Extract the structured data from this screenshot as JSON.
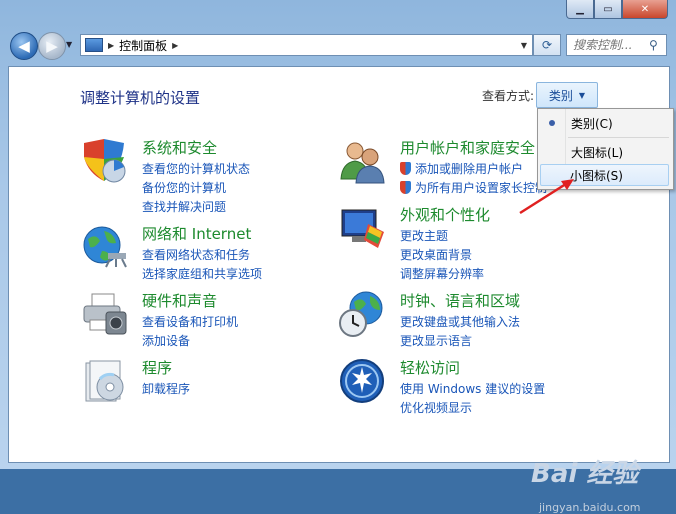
{
  "nav": {
    "address_path": "控制面板",
    "search_placeholder": "搜索控制..."
  },
  "page": {
    "title": "调整计算机的设置",
    "view_by_label": "查看方式:",
    "view_button": "类别"
  },
  "menu": {
    "items": [
      "类别(C)",
      "大图标(L)",
      "小图标(S)"
    ],
    "selected": "类别(C)",
    "highlighted": "小图标(S)"
  },
  "categories": [
    {
      "name": "系统和安全",
      "links": [
        "查看您的计算机状态",
        "备份您的计算机",
        "查找并解决问题"
      ]
    },
    {
      "name": "网络和 Internet",
      "links": [
        "查看网络状态和任务",
        "选择家庭组和共享选项"
      ]
    },
    {
      "name": "硬件和声音",
      "links": [
        "查看设备和打印机",
        "添加设备"
      ]
    },
    {
      "name": "程序",
      "links": [
        "卸载程序"
      ]
    },
    {
      "name": "用户帐户和家庭安全",
      "links": [
        "添加或删除用户帐户",
        "为所有用户设置家长控制"
      ]
    },
    {
      "name": "外观和个性化",
      "links": [
        "更改主题",
        "更改桌面背景",
        "调整屏幕分辨率"
      ]
    },
    {
      "name": "时钟、语言和区域",
      "links": [
        "更改键盘或其他输入法",
        "更改显示语言"
      ]
    },
    {
      "name": "轻松访问",
      "links": [
        "使用 Windows 建议的设置",
        "优化视频显示"
      ]
    }
  ],
  "colors": {
    "heading": "#1d8a2e",
    "link": "#1a56b8",
    "title": "#1e3287",
    "annotation_arrow": "#e02020"
  },
  "watermark": {
    "text": "Bai 经验",
    "url": "jingyan.baidu.com"
  }
}
